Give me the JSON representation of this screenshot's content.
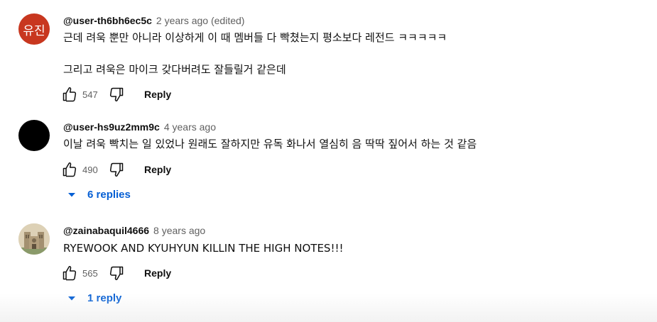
{
  "comments": [
    {
      "author": "@user-th6bh6ec5c",
      "time": "2 years ago (edited)",
      "avatar_text": "유진",
      "avatar_color": "#c8371f",
      "lines": [
        "근데 려욱 뿐만 아니라 이상하게 이 때 멤버들 다 빡쳤는지 평소보다 레전드 ㅋㅋㅋㅋㅋ",
        "그리고 려욱은 마이크 갖다버려도 잘들릴거 같은데"
      ],
      "likes": "547",
      "reply_label": "Reply"
    },
    {
      "author": "@user-hs9uz2mm9c",
      "time": "4 years ago",
      "avatar_color": "#000000",
      "lines": [
        "이날 려욱 빡치는 일 있었나 원래도 잘하지만 유독 화나서 열심히 음 딱딱 짚어서 하는 것 같음"
      ],
      "likes": "490",
      "reply_label": "Reply",
      "replies_label": "6 replies"
    },
    {
      "author": "@zainabaquil4666",
      "time": "8 years ago",
      "avatar_icon": "cathedral-icon",
      "lines": [
        "RYEWOOK AND KYUHYUN  KILLIN THE HIGH NOTES!!!"
      ],
      "likes": "565",
      "reply_label": "Reply",
      "replies_label": "1 reply"
    }
  ],
  "colors": {
    "link_blue": "#065fd4",
    "secondary_text": "#606060"
  }
}
